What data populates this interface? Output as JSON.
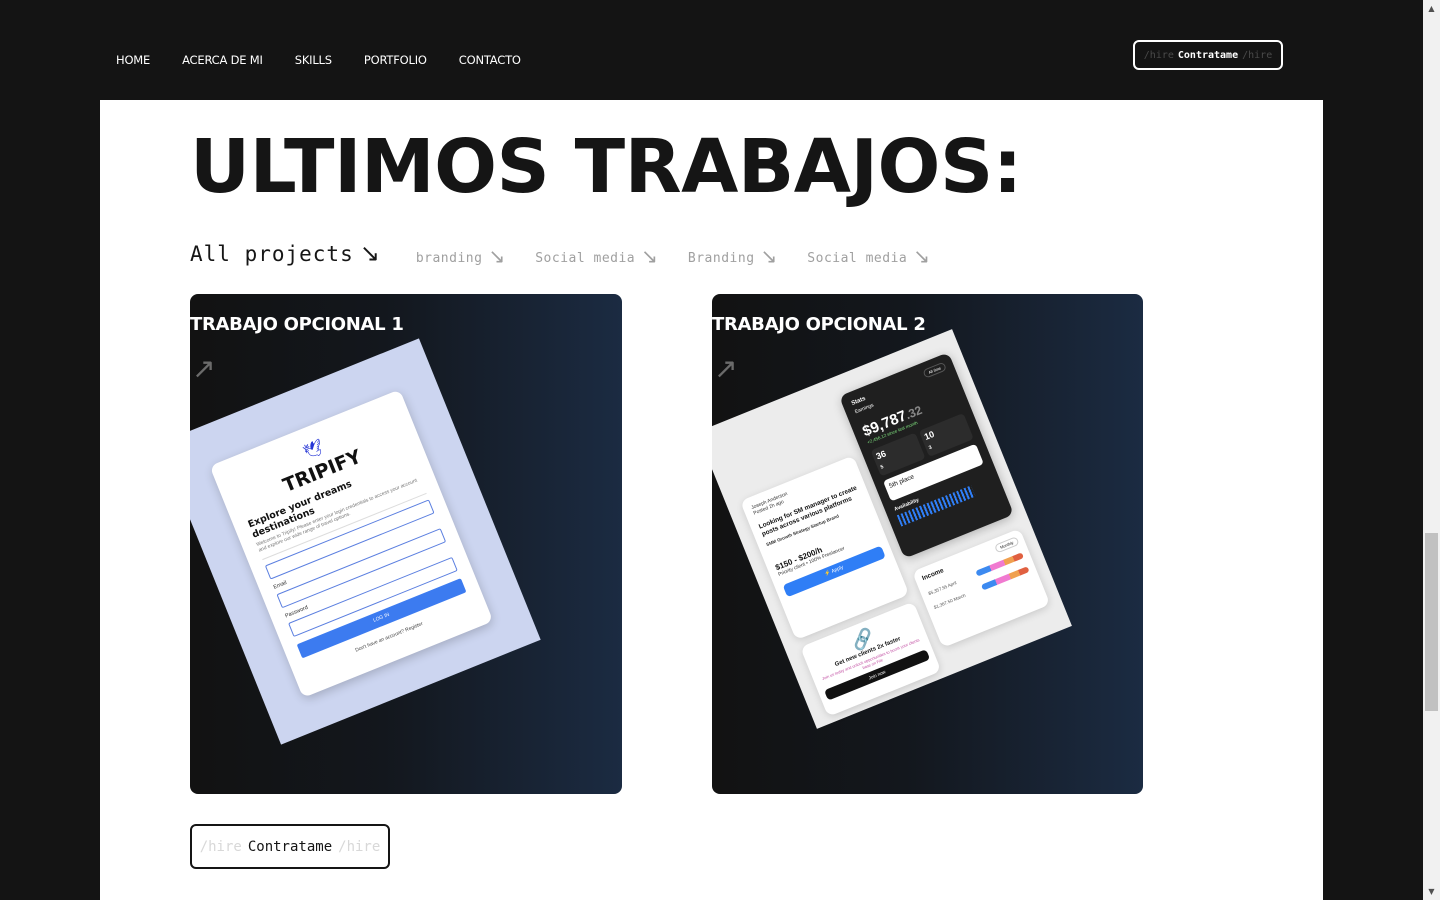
{
  "nav": {
    "links": [
      "HOME",
      "ACERCA DE MI",
      "SKILLS",
      "PORTFOLIO",
      "CONTACTO"
    ],
    "hire": {
      "prefix": "/hire",
      "label": "Contratame",
      "suffix": "/hire"
    }
  },
  "main": {
    "title": "ULTIMOS TRABAJOS:",
    "filters": [
      {
        "label": "All projects",
        "arrow": "↘"
      },
      {
        "label": "branding",
        "arrow": "↘"
      },
      {
        "label": "Social media",
        "arrow": "↘"
      },
      {
        "label": "Branding",
        "arrow": "↘"
      },
      {
        "label": "Social media",
        "arrow": "↘"
      }
    ],
    "cards": [
      {
        "title": "TRABAJO OPCIONAL 1",
        "arrow": "↗"
      },
      {
        "title": "TRABAJO OPCIONAL 2",
        "arrow": "↗"
      }
    ],
    "hire": {
      "prefix": "/hire",
      "label": "Contratame",
      "suffix": "/hire"
    }
  },
  "mockup1": {
    "logo": "🕊",
    "brand": "TRIPIFY",
    "heading": "Explore your dreams destinations",
    "sub": "Welcome to Tripify! Please enter your login credentials to access your account and explore our wide range of travel options.",
    "email_label": "Email",
    "password_label": "Password",
    "button": "LOG IN",
    "footer": "Don't have an account? Register"
  },
  "mockup2": {
    "job": {
      "author": "Joseph Anderson",
      "posted": "Posted 2h ago",
      "heading": "Looking for SM manager to create posts across various platforms",
      "tags": "SMM  Growth Strategy  Startup  Brand",
      "price": "$150 - $200/h",
      "meta": "Priority client • 100% Freelancer",
      "apply": "⚡ Apply"
    },
    "stats": {
      "title": "Stats",
      "pill": "All time",
      "earnings_label": "Earnings",
      "earnings_int": "$9,787",
      "earnings_dec": ".32",
      "delta": "+2,456.12 since last month",
      "box1": "36",
      "box1b": "5",
      "box2": "10",
      "box2b": "3",
      "place": "5th place",
      "availability": "Availability"
    },
    "clients": {
      "icon": "🔗",
      "heading": "Get new clients 2x faster",
      "sub": "Join us today and unlock opportunities to boost your clients base on Fiiir",
      "join": "Join now"
    },
    "income": {
      "title": "Income",
      "pill": "Monthly",
      "row1": "$5,357.55 April",
      "row2": "$1,367.50 March"
    }
  },
  "scrollbar": {
    "up": "▲",
    "down": "▼"
  }
}
